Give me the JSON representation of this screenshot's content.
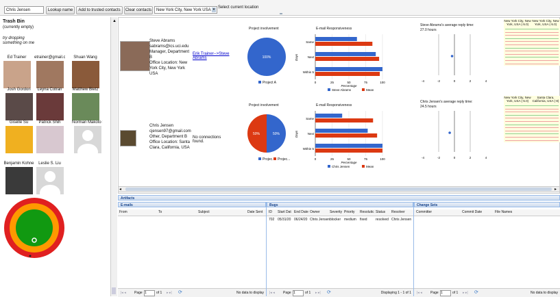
{
  "toolbar": {
    "search_value": "Chris Jensen",
    "lookup_label": "Lookup name",
    "trusted_label": "Add to trusted contacts",
    "clear_label": "Clear contacts",
    "location_value": "New York City, New York USA",
    "current_location_label": "Select current location"
  },
  "sidebar": {
    "trash_title": "Trash Bin",
    "trash_status": "(currently empty)",
    "drop_hint_1": "try dropping",
    "drop_hint_2": "something on me",
    "people": [
      {
        "name": "Ed Trainer",
        "photo": "#c9a38a"
      },
      {
        "name": "etrainer@gmail.com",
        "photo": "#a07860"
      },
      {
        "name": "Shuan Wang",
        "photo": "#8a5a3a"
      },
      {
        "name": "Josh Gordon",
        "photo": "#5a4a48"
      },
      {
        "name": "Leyna Cotran",
        "photo": "#6a3a3a"
      },
      {
        "name": "Matthew Bietz",
        "photo": "#6a8a5a"
      },
      {
        "name": "Giselle Su",
        "photo": "#f0b020"
      },
      {
        "name": "Patrick Shih",
        "photo": "#d8c8d0"
      },
      {
        "name": "Norman Makoto Su",
        "photo": "#d8d8d8"
      },
      {
        "name": "Benjamin Kohne",
        "photo": "#3a3a3a"
      },
      {
        "name": "Leslie S. Liu",
        "photo": "#d8d8d8"
      }
    ]
  },
  "contacts": [
    {
      "info": [
        "Steve Abrams",
        "sabrams@ics.uci.edu",
        "Manager, Department",
        "B",
        "Office Location: New",
        "York City, New York",
        "USA"
      ],
      "connection": "Erik Trainer-->Steve Abrams",
      "involvement_title": "Project involvement",
      "pie_label": "100%",
      "pie_legend": [
        "Project A"
      ],
      "email_title": "E-mail Responsiveness",
      "reply_title": "Steve Abrams's average reply time:",
      "reply_value": "27.0 hours",
      "loc_headers": [
        "New York City, New York, USA (-5.0)",
        "New York City, New York, USA (-5.0)"
      ]
    },
    {
      "info": [
        "Chris Jensen",
        "cjensen97@gmail.com",
        "Other, Department B",
        "Office Location: Santa",
        "Clara, California, USA"
      ],
      "connection": "No connections found.",
      "involvement_title": "Project involvement",
      "pie_labels": [
        "50%",
        "50%"
      ],
      "pie_legend": [
        "Projec...",
        "Projec..."
      ],
      "email_title": "E-mail Responsiveness",
      "reply_title": "Chris Jensen's average reply time:",
      "reply_value": "24.5 hours",
      "loc_headers": [
        "New York City, New York, USA (-5.0)",
        "Santa Clara, California, USA (-8)"
      ]
    }
  ],
  "chart_data": [
    {
      "type": "pie",
      "title": "Project involvement",
      "slices": [
        {
          "name": "Project A",
          "value": 100
        }
      ]
    },
    {
      "type": "bar",
      "title": "E-mail Responsiveness",
      "ylabel": "Days",
      "xlabel": "Percentage",
      "categories": [
        "Same",
        "Next",
        "Within 5"
      ],
      "xlim": [
        0,
        100
      ],
      "xticks": [
        "0",
        "25",
        "50",
        "75",
        "100"
      ],
      "series": [
        {
          "name": "Steve Abrams",
          "values": [
            62,
            90,
            100
          ]
        },
        {
          "name": "Mean",
          "values": [
            85,
            95,
            96
          ]
        }
      ]
    },
    {
      "type": "scatter",
      "title": "Steve Abrams's average reply time:",
      "xlim": [
        -4,
        4
      ],
      "xticks": [
        "-4",
        "-2",
        "0",
        "2",
        "4"
      ],
      "points": [
        [
          -0.3,
          0
        ]
      ]
    },
    {
      "type": "pie",
      "title": "Project involvement",
      "slices": [
        {
          "name": "Projec...",
          "value": 50
        },
        {
          "name": "Projec...",
          "value": 50
        }
      ]
    },
    {
      "type": "bar",
      "title": "E-mail Responsiveness",
      "ylabel": "Days",
      "xlabel": "Percentage",
      "categories": [
        "Same",
        "Next",
        "Within 5"
      ],
      "xlim": [
        0,
        100
      ],
      "xticks": [
        "0",
        "25",
        "50",
        "75",
        "100"
      ],
      "series": [
        {
          "name": "Chris Jensen",
          "values": [
            40,
            78,
            100
          ]
        },
        {
          "name": "Mean",
          "values": [
            86,
            92,
            100
          ]
        }
      ]
    },
    {
      "type": "scatter",
      "title": "Chris Jensen's average reply time:",
      "xlim": [
        -4,
        4
      ],
      "xticks": [
        "-4",
        "-2",
        "0",
        "2",
        "4"
      ],
      "points": [
        [
          -0.6,
          0
        ]
      ]
    }
  ],
  "artifacts": {
    "title": "Artifacts",
    "emails": {
      "title": "E-mails",
      "columns": [
        "From",
        "To",
        "Subject",
        "Date Sent"
      ],
      "pager": "Page",
      "of": "of 1",
      "page_value": "1",
      "status": "No data to display"
    },
    "bugs": {
      "title": "Bugs",
      "columns": [
        "ID",
        "Start Dat",
        "End Date",
        "Owner",
        "Severity",
        "Priority",
        "Resolutic",
        "Status",
        "Resolver"
      ],
      "rows": [
        [
          "702",
          "05/31/20",
          "06/24/20",
          "Chris Jensen",
          "blocker",
          "medium",
          "fixed",
          "resolved",
          "Chris Jensen"
        ]
      ],
      "pager": "Page",
      "of": "of 1",
      "page_value": "1",
      "status": "Displaying 1 - 1 of 1"
    },
    "changes": {
      "title": "Change Sets",
      "columns": [
        "Committer",
        "Commit Date",
        "File Names"
      ],
      "pager": "Page",
      "of": "of 1",
      "page_value": "1",
      "status": "No data to display"
    }
  },
  "colors": {
    "blue": "#3366cc",
    "red": "#dc3912",
    "ring_red": "#e02020",
    "ring_orange": "#ff9900",
    "ring_green": "#119911"
  }
}
